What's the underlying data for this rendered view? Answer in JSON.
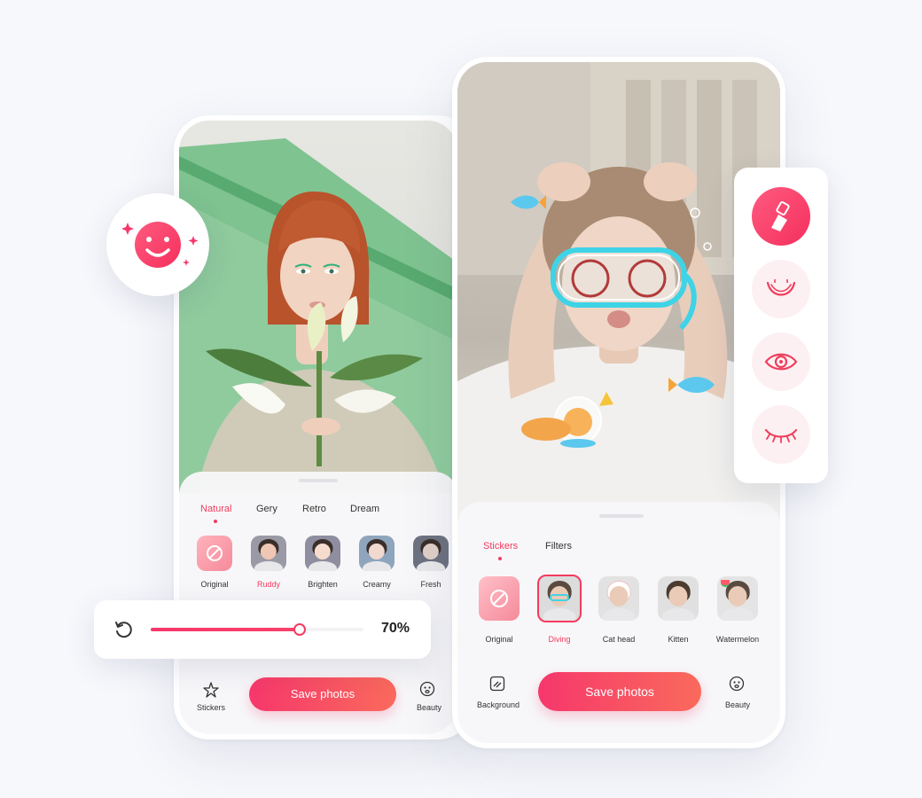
{
  "left_phone": {
    "filter_tabs": [
      {
        "label": "Natural",
        "active": true
      },
      {
        "label": "Gery",
        "active": false
      },
      {
        "label": "Retro",
        "active": false
      },
      {
        "label": "Dream",
        "active": false
      }
    ],
    "filters": [
      {
        "label": "Original",
        "active": false
      },
      {
        "label": "Ruddy",
        "active": true
      },
      {
        "label": "Brighten",
        "active": false
      },
      {
        "label": "Creamy",
        "active": false
      },
      {
        "label": "Fresh",
        "active": false
      }
    ],
    "save_label": "Save photos",
    "nav_left_label": "Stickers",
    "nav_right_label": "Beauty"
  },
  "slider": {
    "value_label": "70%",
    "value": 0.7
  },
  "right_phone": {
    "tabs": [
      {
        "label": "Stickers",
        "active": true
      },
      {
        "label": "Filters",
        "active": false
      }
    ],
    "stickers": [
      {
        "label": "Original",
        "active": false
      },
      {
        "label": "Diving",
        "active": true
      },
      {
        "label": "Cat head",
        "active": false
      },
      {
        "label": "Kitten",
        "active": false
      },
      {
        "label": "Watermelon",
        "active": false
      }
    ],
    "save_label": "Save photos",
    "nav_left_label": "Background",
    "nav_right_label": "Beauty"
  },
  "beauty_tools": [
    {
      "icon": "brush-icon",
      "active": true
    },
    {
      "icon": "lips-icon",
      "active": false
    },
    {
      "icon": "eye-icon",
      "active": false
    },
    {
      "icon": "eyelash-icon",
      "active": false
    }
  ],
  "colors": {
    "accent": "#f43b5e",
    "gradient_start": "#f6376b",
    "gradient_end": "#fa6a5c",
    "background": "#f7f8fc"
  }
}
